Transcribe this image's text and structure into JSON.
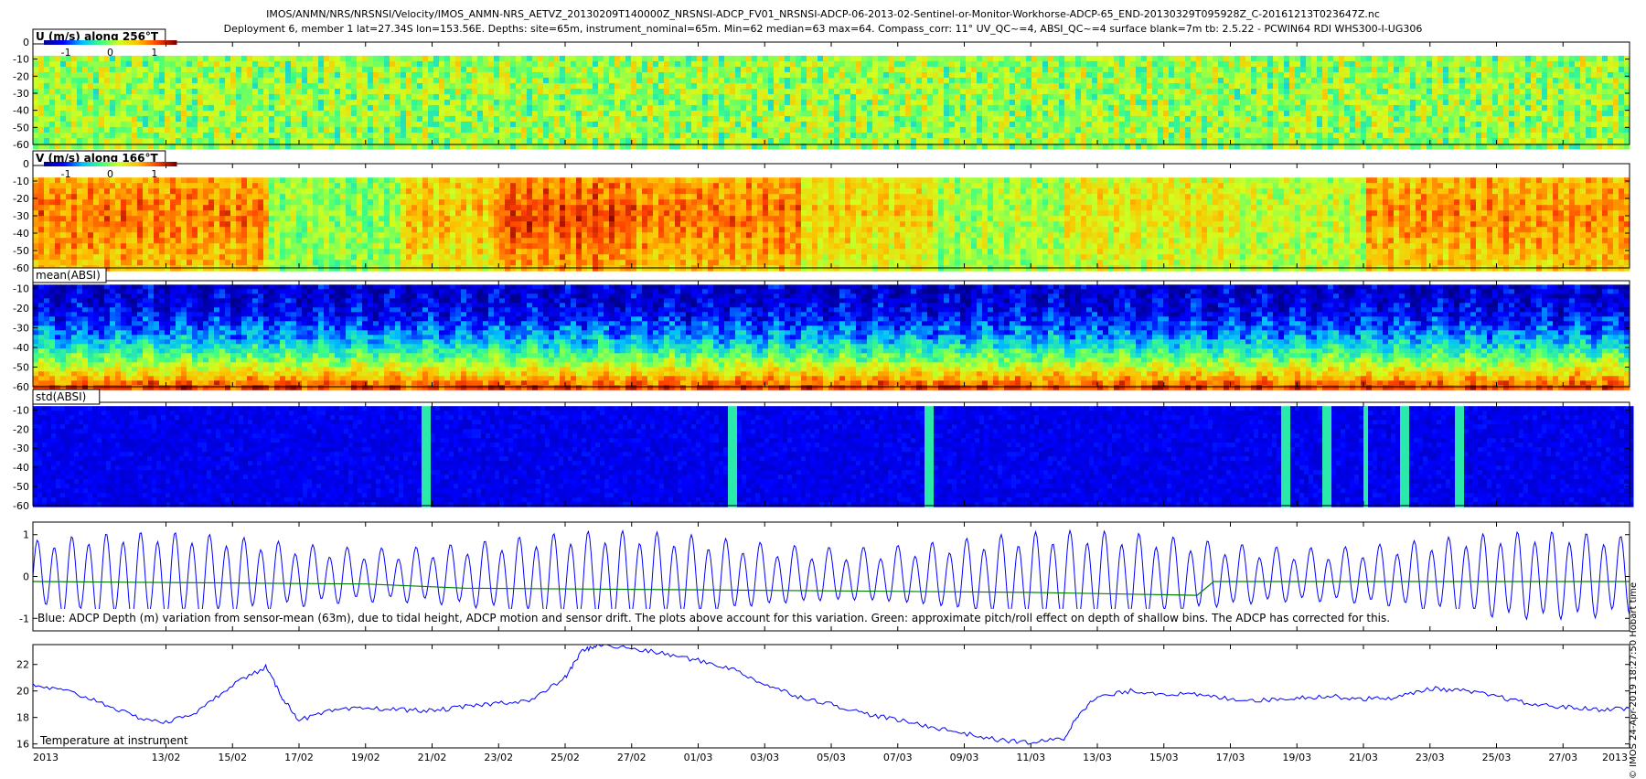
{
  "title_lines": [
    "IMOS/ANMN/NRS/NRSNSI/Velocity/IMOS_ANMN-NRS_AETVZ_20130209T140000Z_NRSNSI-ADCP_FV01_NRSNSI-ADCP-06-2013-02-Sentinel-or-Monitor-Workhorse-ADCP-65_END-20130329T095928Z_C-20161213T023647Z.nc",
    "Deployment 6, member 1 lat=27.34S lon=153.56E. Depths: site=65m, instrument_nominal=65m. Min=62 median=63 max=64. Compass_corr: 11° UV_QC~=4, ABSI_QC~=4 surface blank=7m tb: 2.5.22 - PCWIN64 RDI WHS300-I-UG306"
  ],
  "side_note": "© IMOS 24-Apr-2019 18:27:50 Hobart time",
  "x_axis": {
    "start_label": "2013",
    "end_label": "2013",
    "date_ticks": [
      "13/02",
      "15/02",
      "17/02",
      "19/02",
      "21/02",
      "23/02",
      "25/02",
      "27/02",
      "01/03",
      "03/03",
      "05/03",
      "07/03",
      "09/03",
      "11/03",
      "13/03",
      "15/03",
      "17/03",
      "19/03",
      "21/03",
      "23/03",
      "25/03",
      "27/03"
    ]
  },
  "colorbar_ticks": [
    "-1",
    "0",
    "1"
  ],
  "colors": {
    "blue_line": "#0000ff",
    "green_line": "#008000",
    "jet": [
      "#00008f",
      "#0000ff",
      "#00bfff",
      "#40ff80",
      "#d0ff20",
      "#ffbf00",
      "#ff4000",
      "#800000"
    ]
  },
  "chart_data": [
    {
      "type": "heatmap",
      "label": "U (m/s) along 256°T",
      "y_ticks": [
        "0",
        "-10",
        "-20",
        "-30",
        "-40",
        "-50",
        "-60"
      ],
      "ylim": [
        -60,
        0
      ],
      "colorbar": true,
      "clim": [
        -1.5,
        1.5
      ],
      "description_values": "mostly near 0 m/s (green), weak positive/negative streaks"
    },
    {
      "type": "heatmap",
      "label": "V (m/s) along 166°T",
      "y_ticks": [
        "0",
        "-10",
        "-20",
        "-30",
        "-40",
        "-50",
        "-60"
      ],
      "ylim": [
        -60,
        0
      ],
      "colorbar": true,
      "clim": [
        -1.5,
        1.5
      ],
      "segments_days_from_start_value": [
        {
          "start": 0,
          "end": 7,
          "value": 0.9
        },
        {
          "start": 7,
          "end": 11,
          "value": 0.0
        },
        {
          "start": 11,
          "end": 14,
          "value": 0.6
        },
        {
          "start": 14,
          "end": 18,
          "value": 1.1
        },
        {
          "start": 18,
          "end": 23,
          "value": 0.9
        },
        {
          "start": 23,
          "end": 27,
          "value": 0.5
        },
        {
          "start": 27,
          "end": 31,
          "value": 0.1
        },
        {
          "start": 31,
          "end": 36,
          "value": 0.4
        },
        {
          "start": 36,
          "end": 40,
          "value": 0.2
        },
        {
          "start": 40,
          "end": 48,
          "value": 0.8
        }
      ]
    },
    {
      "type": "heatmap",
      "label": "mean(ABSI)",
      "y_ticks": [
        "-10",
        "-20",
        "-30",
        "-40",
        "-50",
        "-60"
      ],
      "ylim": [
        -60,
        -6
      ],
      "colorbar": false,
      "description_values": "low (blue) near top, increasing to high (red/orange) near -55 m"
    },
    {
      "type": "heatmap",
      "label": "std(ABSI)",
      "y_ticks": [
        "-10",
        "-20",
        "-30",
        "-40",
        "-50",
        "-60"
      ],
      "ylim": [
        -60,
        -6
      ],
      "colorbar": false,
      "description_values": "uniformly low (blue) with a few vertical cyan streaks"
    },
    {
      "type": "line",
      "label": "Blue: ADCP Depth (m) variation from sensor-mean (63m), due to tidal height, ADCP motion and sensor drift. The plots above account for this variation. Green: approximate pitch/roll effect on depth of shallow bins. The ADCP has corrected for this.",
      "y_ticks": [
        "1",
        "0",
        "-1"
      ],
      "ylim": [
        -1.3,
        1.3
      ],
      "series": [
        {
          "name": "Blue",
          "color": "#0000ff",
          "description": "semi-diurnal tidal oscillation, amplitude ~0.8-1 m, ~12.4 h period"
        },
        {
          "name": "Green",
          "color": "#008000",
          "points": [
            [
              0,
              -0.12
            ],
            [
              10,
              -0.18
            ],
            [
              13,
              -0.28
            ],
            [
              20,
              -0.32
            ],
            [
              30,
              -0.38
            ],
            [
              35,
              -0.45
            ],
            [
              35.5,
              -0.12
            ],
            [
              48,
              -0.12
            ]
          ]
        }
      ]
    },
    {
      "type": "line",
      "label": "Temperature at instrument",
      "y_ticks": [
        "22",
        "20",
        "18",
        "16"
      ],
      "ylim": [
        15.7,
        23.5
      ],
      "series": [
        {
          "points": [
            [
              0,
              20.4
            ],
            [
              1,
              20.0
            ],
            [
              2,
              19.2
            ],
            [
              3,
              18.1
            ],
            [
              4,
              17.6
            ],
            [
              5,
              18.5
            ],
            [
              6,
              20.5
            ],
            [
              7,
              21.8
            ],
            [
              7.5,
              19.5
            ],
            [
              8,
              17.8
            ],
            [
              9,
              18.5
            ],
            [
              10,
              18.7
            ],
            [
              11,
              18.6
            ],
            [
              12,
              18.5
            ],
            [
              13,
              18.8
            ],
            [
              14,
              19.1
            ],
            [
              15,
              19.3
            ],
            [
              16,
              21.0
            ],
            [
              16.5,
              23.0
            ],
            [
              17,
              23.5
            ],
            [
              18,
              23.2
            ],
            [
              19,
              22.8
            ],
            [
              20,
              22.3
            ],
            [
              21,
              21.7
            ],
            [
              22,
              20.5
            ],
            [
              23,
              19.6
            ],
            [
              24,
              19.0
            ],
            [
              25,
              18.3
            ],
            [
              26,
              17.8
            ],
            [
              27,
              17.3
            ],
            [
              28,
              16.8
            ],
            [
              29,
              16.3
            ],
            [
              30,
              16.1
            ],
            [
              31,
              16.4
            ],
            [
              31.5,
              18.5
            ],
            [
              32,
              19.5
            ],
            [
              33,
              20.0
            ],
            [
              34,
              19.8
            ],
            [
              35,
              19.7
            ],
            [
              36,
              19.4
            ],
            [
              37,
              19.3
            ],
            [
              38,
              19.5
            ],
            [
              39,
              19.6
            ],
            [
              40,
              19.4
            ],
            [
              41,
              19.5
            ],
            [
              42,
              20.2
            ],
            [
              43,
              20.0
            ],
            [
              44,
              19.6
            ],
            [
              45,
              19.0
            ],
            [
              46,
              18.8
            ],
            [
              47,
              18.6
            ],
            [
              48,
              18.7
            ]
          ]
        }
      ]
    }
  ]
}
